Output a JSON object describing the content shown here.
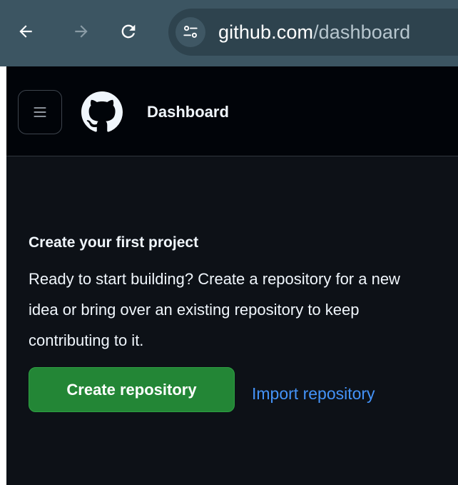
{
  "browser": {
    "url_host": "github.com",
    "url_path": "/dashboard",
    "icons": {
      "back": "arrow-left-icon",
      "forward": "arrow-right-icon",
      "reload": "reload-icon",
      "site_info": "tune-icon"
    }
  },
  "header": {
    "title": "Dashboard",
    "icons": {
      "menu": "hamburger-menu-icon",
      "logo": "github-logo-icon"
    }
  },
  "onboarding": {
    "title": "Create your first project",
    "description": "Ready to start building? Create a repository for a new idea or bring over an existing repository to keep contributing to it.",
    "primary_button": "Create repository",
    "secondary_link": "Import repository"
  },
  "colors": {
    "browser_chrome": "#3c5562",
    "page_background": "#0d1117",
    "header_background": "#010409",
    "primary_button": "#238636",
    "link": "#4493f8"
  }
}
